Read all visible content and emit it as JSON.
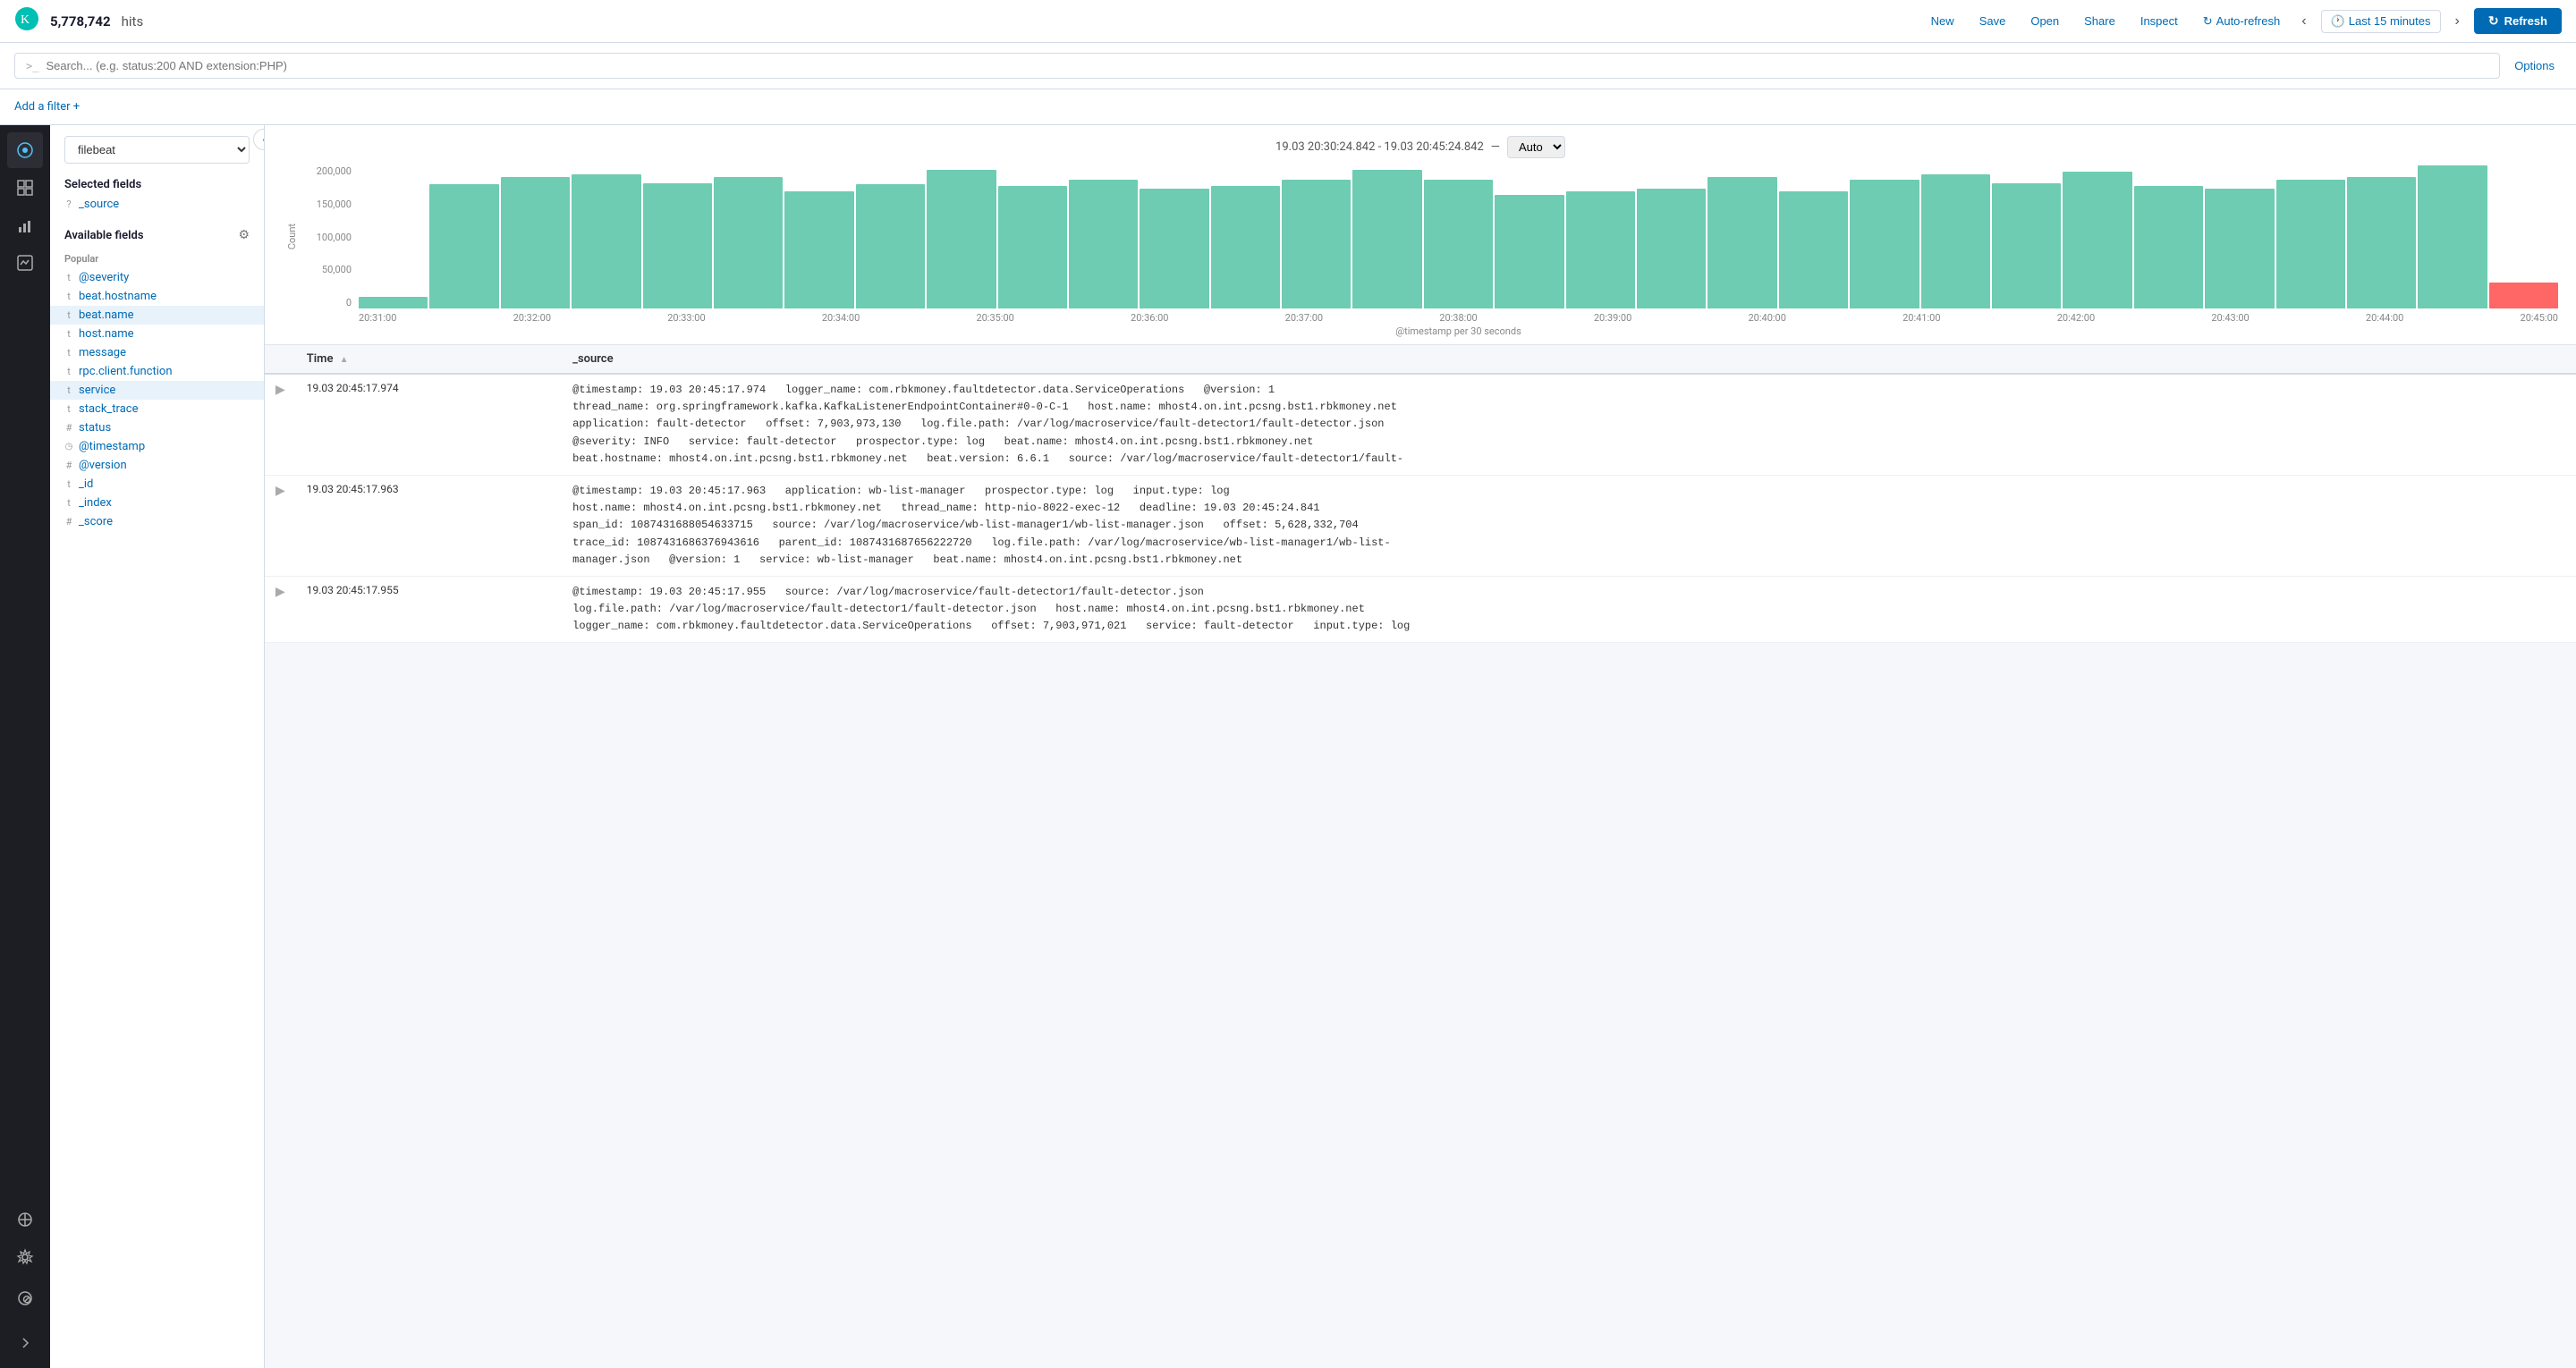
{
  "topbar": {
    "hits": "5,778,742",
    "hits_label": "hits",
    "new_label": "New",
    "save_label": "Save",
    "open_label": "Open",
    "share_label": "Share",
    "inspect_label": "Inspect",
    "auto_refresh_label": "Auto-refresh",
    "time_range_label": "Last 15 minutes",
    "refresh_label": "Refresh"
  },
  "search": {
    "placeholder": "Search... (e.g. status:200 AND extension:PHP)",
    "prompt": ">_",
    "options_label": "Options"
  },
  "filter_bar": {
    "add_filter_label": "Add a filter +"
  },
  "sidebar": {
    "index": "filebeat",
    "selected_fields_label": "Selected fields",
    "selected_fields": [
      {
        "type": "?",
        "name": "_source"
      }
    ],
    "available_fields_label": "Available fields",
    "popular_label": "Popular",
    "fields": [
      {
        "type": "t",
        "name": "@severity"
      },
      {
        "type": "t",
        "name": "beat.hostname"
      },
      {
        "type": "t",
        "name": "beat.name"
      },
      {
        "type": "t",
        "name": "host.name"
      },
      {
        "type": "t",
        "name": "message"
      },
      {
        "type": "t",
        "name": "rpc.client.function"
      },
      {
        "type": "t",
        "name": "service"
      },
      {
        "type": "t",
        "name": "stack_trace"
      },
      {
        "type": "#",
        "name": "status"
      },
      {
        "type": "◷",
        "name": "@timestamp"
      },
      {
        "type": "#",
        "name": "@version"
      },
      {
        "type": "t",
        "name": "_id"
      },
      {
        "type": "t",
        "name": "_index"
      },
      {
        "type": "#",
        "name": "_score"
      }
    ]
  },
  "chart": {
    "time_range": "19.03 20:30:24.842 - 19.03 20:45:24.842",
    "separator": "—",
    "auto_label": "Auto",
    "x_label": "@timestamp per 30 seconds",
    "y_labels": [
      "200,000",
      "150,000",
      "100,000",
      "50,000",
      "0"
    ],
    "x_labels": [
      "20:31:00",
      "20:32:00",
      "20:33:00",
      "20:34:00",
      "20:35:00",
      "20:36:00",
      "20:37:00",
      "20:38:00",
      "20:39:00",
      "20:40:00",
      "20:41:00",
      "20:42:00",
      "20:43:00",
      "20:44:00",
      "20:45:00"
    ],
    "bars": [
      5,
      85,
      90,
      92,
      86,
      90,
      80,
      85,
      95,
      84,
      88,
      82,
      84,
      88,
      95,
      88,
      78,
      80,
      82,
      90,
      80,
      88,
      92,
      86,
      94,
      84,
      82,
      88,
      90,
      98,
      18
    ],
    "count_label": "Count"
  },
  "table": {
    "col_time": "Time",
    "col_source": "_source",
    "rows": [
      {
        "time": "19.03 20:45:17.974",
        "source": "@timestamp: 19.03 20:45:17.974   logger_name: com.rbkmoney.faultdetector.data.ServiceOperations   @version: 1   thread_name: org.springframework.kafka.KafkaListenerEndpointContainer#0-0-C-1   host.name: mhost4.on.int.pcsng.bst1.rbkmoney.net   application: fault-detector   offset: 7,903,973,130   log.file.path: /var/log/macroservice/fault-detector1/fault-detector.json   @severity: INFO   service: fault-detector   prospector.type: log   beat.name: mhost4.on.int.pcsng.bst1.rbkmoney.net   beat.hostname: mhost4.on.int.pcsng.bst1.rbkmoney.net   beat.version: 6.6.1   source: /var/log/macroservice/fault-detector1/fault-"
      },
      {
        "time": "19.03 20:45:17.963",
        "source": "@timestamp: 19.03 20:45:17.963   application: wb-list-manager   prospector.type: log   input.type: log   host.name: mhost4.on.int.pcsng.bst1.rbkmoney.net   thread_name: http-nio-8022-exec-12   deadline: 19.03 20:45:24.841   span_id: 1087431688054633715   source: /var/log/macroservice/wb-list-manager1/wb-list-manager.json   offset: 5,628,332,704   trace_id: 1087431686376943616   parent_id: 1087431687656222720   log.file.path: /var/log/macroservice/wb-list-manager1/wb-list-manager.json   @version: 1   service: wb-list-manager   beat.name: mhost4.on.int.pcsng.bst1.rbkmoney.net"
      },
      {
        "time": "19.03 20:45:17.955",
        "source": "@timestamp: 19.03 20:45:17.955   source: /var/log/macroservice/fault-detector1/fault-detector.json   log.file.path: /var/log/macroservice/fault-detector1/fault-detector.json   host.name: mhost4.on.int.pcsng.bst1.rbkmoney.net   logger_name: com.rbkmoney.faultdetector.data.ServiceOperations   offset: 7,903,971,021   service: fault-detector   input.type: log"
      }
    ]
  },
  "nav_icons": [
    {
      "icon": "⊙",
      "name": "discover-icon",
      "active": true
    },
    {
      "icon": "◫",
      "name": "dashboard-icon",
      "active": false
    },
    {
      "icon": "⌖",
      "name": "visualize-icon",
      "active": false
    },
    {
      "icon": "◉",
      "name": "canvas-icon",
      "active": false
    },
    {
      "icon": "⚙",
      "name": "dev-tools-icon",
      "active": false
    },
    {
      "icon": "⊕",
      "name": "management-icon",
      "active": false
    },
    {
      "icon": "⊘",
      "name": "security-icon",
      "active": false
    }
  ]
}
